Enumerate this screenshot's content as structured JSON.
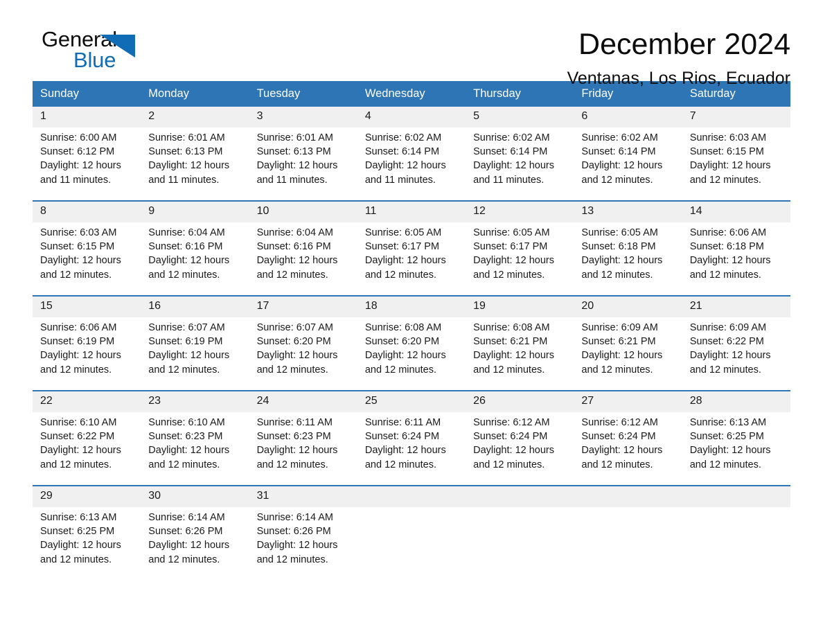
{
  "brand": {
    "name_part1": "General",
    "name_part2": "Blue",
    "logo_icon": "triangle-logo-icon",
    "accent_color": "#0f6cb5"
  },
  "header": {
    "title": "December 2024",
    "subtitle": "Ventanas, Los Rios, Ecuador"
  },
  "theme": {
    "header_blue": "#2e75b6",
    "daynum_band": "#f0f0f0",
    "page_background": "#ffffff",
    "text_color": "#1a1a1a"
  },
  "calendar": {
    "weekday_headers": [
      "Sunday",
      "Monday",
      "Tuesday",
      "Wednesday",
      "Thursday",
      "Friday",
      "Saturday"
    ],
    "weeks": [
      {
        "days": [
          {
            "date": "1",
            "sunrise": "Sunrise: 6:00 AM",
            "sunset": "Sunset: 6:12 PM",
            "daylight_line1": "Daylight: 12 hours",
            "daylight_line2": "and 11 minutes."
          },
          {
            "date": "2",
            "sunrise": "Sunrise: 6:01 AM",
            "sunset": "Sunset: 6:13 PM",
            "daylight_line1": "Daylight: 12 hours",
            "daylight_line2": "and 11 minutes."
          },
          {
            "date": "3",
            "sunrise": "Sunrise: 6:01 AM",
            "sunset": "Sunset: 6:13 PM",
            "daylight_line1": "Daylight: 12 hours",
            "daylight_line2": "and 11 minutes."
          },
          {
            "date": "4",
            "sunrise": "Sunrise: 6:02 AM",
            "sunset": "Sunset: 6:14 PM",
            "daylight_line1": "Daylight: 12 hours",
            "daylight_line2": "and 11 minutes."
          },
          {
            "date": "5",
            "sunrise": "Sunrise: 6:02 AM",
            "sunset": "Sunset: 6:14 PM",
            "daylight_line1": "Daylight: 12 hours",
            "daylight_line2": "and 11 minutes."
          },
          {
            "date": "6",
            "sunrise": "Sunrise: 6:02 AM",
            "sunset": "Sunset: 6:14 PM",
            "daylight_line1": "Daylight: 12 hours",
            "daylight_line2": "and 12 minutes."
          },
          {
            "date": "7",
            "sunrise": "Sunrise: 6:03 AM",
            "sunset": "Sunset: 6:15 PM",
            "daylight_line1": "Daylight: 12 hours",
            "daylight_line2": "and 12 minutes."
          }
        ]
      },
      {
        "days": [
          {
            "date": "8",
            "sunrise": "Sunrise: 6:03 AM",
            "sunset": "Sunset: 6:15 PM",
            "daylight_line1": "Daylight: 12 hours",
            "daylight_line2": "and 12 minutes."
          },
          {
            "date": "9",
            "sunrise": "Sunrise: 6:04 AM",
            "sunset": "Sunset: 6:16 PM",
            "daylight_line1": "Daylight: 12 hours",
            "daylight_line2": "and 12 minutes."
          },
          {
            "date": "10",
            "sunrise": "Sunrise: 6:04 AM",
            "sunset": "Sunset: 6:16 PM",
            "daylight_line1": "Daylight: 12 hours",
            "daylight_line2": "and 12 minutes."
          },
          {
            "date": "11",
            "sunrise": "Sunrise: 6:05 AM",
            "sunset": "Sunset: 6:17 PM",
            "daylight_line1": "Daylight: 12 hours",
            "daylight_line2": "and 12 minutes."
          },
          {
            "date": "12",
            "sunrise": "Sunrise: 6:05 AM",
            "sunset": "Sunset: 6:17 PM",
            "daylight_line1": "Daylight: 12 hours",
            "daylight_line2": "and 12 minutes."
          },
          {
            "date": "13",
            "sunrise": "Sunrise: 6:05 AM",
            "sunset": "Sunset: 6:18 PM",
            "daylight_line1": "Daylight: 12 hours",
            "daylight_line2": "and 12 minutes."
          },
          {
            "date": "14",
            "sunrise": "Sunrise: 6:06 AM",
            "sunset": "Sunset: 6:18 PM",
            "daylight_line1": "Daylight: 12 hours",
            "daylight_line2": "and 12 minutes."
          }
        ]
      },
      {
        "days": [
          {
            "date": "15",
            "sunrise": "Sunrise: 6:06 AM",
            "sunset": "Sunset: 6:19 PM",
            "daylight_line1": "Daylight: 12 hours",
            "daylight_line2": "and 12 minutes."
          },
          {
            "date": "16",
            "sunrise": "Sunrise: 6:07 AM",
            "sunset": "Sunset: 6:19 PM",
            "daylight_line1": "Daylight: 12 hours",
            "daylight_line2": "and 12 minutes."
          },
          {
            "date": "17",
            "sunrise": "Sunrise: 6:07 AM",
            "sunset": "Sunset: 6:20 PM",
            "daylight_line1": "Daylight: 12 hours",
            "daylight_line2": "and 12 minutes."
          },
          {
            "date": "18",
            "sunrise": "Sunrise: 6:08 AM",
            "sunset": "Sunset: 6:20 PM",
            "daylight_line1": "Daylight: 12 hours",
            "daylight_line2": "and 12 minutes."
          },
          {
            "date": "19",
            "sunrise": "Sunrise: 6:08 AM",
            "sunset": "Sunset: 6:21 PM",
            "daylight_line1": "Daylight: 12 hours",
            "daylight_line2": "and 12 minutes."
          },
          {
            "date": "20",
            "sunrise": "Sunrise: 6:09 AM",
            "sunset": "Sunset: 6:21 PM",
            "daylight_line1": "Daylight: 12 hours",
            "daylight_line2": "and 12 minutes."
          },
          {
            "date": "21",
            "sunrise": "Sunrise: 6:09 AM",
            "sunset": "Sunset: 6:22 PM",
            "daylight_line1": "Daylight: 12 hours",
            "daylight_line2": "and 12 minutes."
          }
        ]
      },
      {
        "days": [
          {
            "date": "22",
            "sunrise": "Sunrise: 6:10 AM",
            "sunset": "Sunset: 6:22 PM",
            "daylight_line1": "Daylight: 12 hours",
            "daylight_line2": "and 12 minutes."
          },
          {
            "date": "23",
            "sunrise": "Sunrise: 6:10 AM",
            "sunset": "Sunset: 6:23 PM",
            "daylight_line1": "Daylight: 12 hours",
            "daylight_line2": "and 12 minutes."
          },
          {
            "date": "24",
            "sunrise": "Sunrise: 6:11 AM",
            "sunset": "Sunset: 6:23 PM",
            "daylight_line1": "Daylight: 12 hours",
            "daylight_line2": "and 12 minutes."
          },
          {
            "date": "25",
            "sunrise": "Sunrise: 6:11 AM",
            "sunset": "Sunset: 6:24 PM",
            "daylight_line1": "Daylight: 12 hours",
            "daylight_line2": "and 12 minutes."
          },
          {
            "date": "26",
            "sunrise": "Sunrise: 6:12 AM",
            "sunset": "Sunset: 6:24 PM",
            "daylight_line1": "Daylight: 12 hours",
            "daylight_line2": "and 12 minutes."
          },
          {
            "date": "27",
            "sunrise": "Sunrise: 6:12 AM",
            "sunset": "Sunset: 6:24 PM",
            "daylight_line1": "Daylight: 12 hours",
            "daylight_line2": "and 12 minutes."
          },
          {
            "date": "28",
            "sunrise": "Sunrise: 6:13 AM",
            "sunset": "Sunset: 6:25 PM",
            "daylight_line1": "Daylight: 12 hours",
            "daylight_line2": "and 12 minutes."
          }
        ]
      },
      {
        "days": [
          {
            "date": "29",
            "sunrise": "Sunrise: 6:13 AM",
            "sunset": "Sunset: 6:25 PM",
            "daylight_line1": "Daylight: 12 hours",
            "daylight_line2": "and 12 minutes."
          },
          {
            "date": "30",
            "sunrise": "Sunrise: 6:14 AM",
            "sunset": "Sunset: 6:26 PM",
            "daylight_line1": "Daylight: 12 hours",
            "daylight_line2": "and 12 minutes."
          },
          {
            "date": "31",
            "sunrise": "Sunrise: 6:14 AM",
            "sunset": "Sunset: 6:26 PM",
            "daylight_line1": "Daylight: 12 hours",
            "daylight_line2": "and 12 minutes."
          },
          {
            "date": "",
            "sunrise": "",
            "sunset": "",
            "daylight_line1": "",
            "daylight_line2": ""
          },
          {
            "date": "",
            "sunrise": "",
            "sunset": "",
            "daylight_line1": "",
            "daylight_line2": ""
          },
          {
            "date": "",
            "sunrise": "",
            "sunset": "",
            "daylight_line1": "",
            "daylight_line2": ""
          },
          {
            "date": "",
            "sunrise": "",
            "sunset": "",
            "daylight_line1": "",
            "daylight_line2": ""
          }
        ]
      }
    ]
  }
}
